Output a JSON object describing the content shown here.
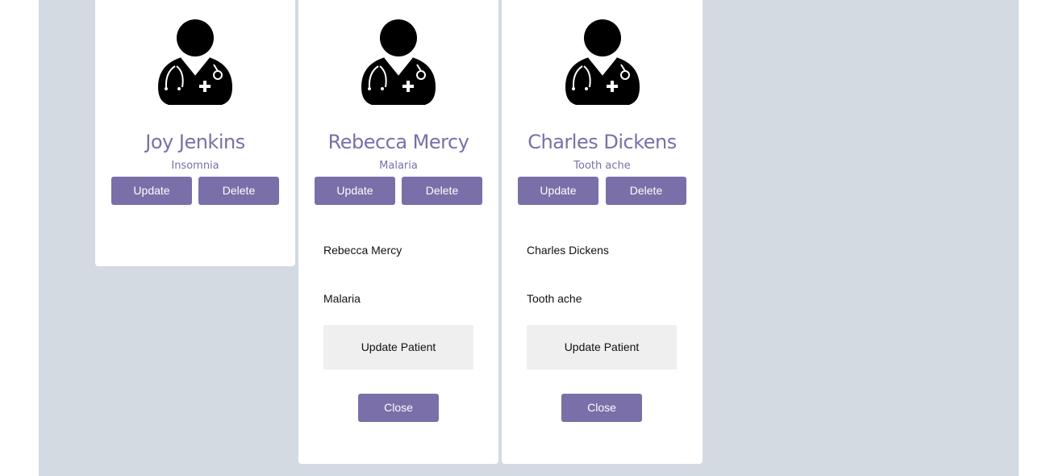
{
  "colors": {
    "accent": "#7a6fa8",
    "panel_background": "#d3dae2",
    "card_background": "#ffffff",
    "secondary_button": "#efefef"
  },
  "cards": [
    {
      "icon": "doctor-icon",
      "name": "Joy Jenkins",
      "ailment": "Insomnia",
      "update_label": "Update",
      "delete_label": "Delete"
    },
    {
      "icon": "doctor-icon",
      "name": "Rebecca Mercy",
      "ailment": "Malaria",
      "update_label": "Update",
      "delete_label": "Delete",
      "form": {
        "name": "Rebecca Mercy",
        "ailment": "Malaria",
        "update_patient_label": "Update Patient",
        "close_label": "Close"
      }
    },
    {
      "icon": "doctor-icon",
      "name": "Charles Dickens",
      "ailment": "Tooth ache",
      "update_label": "Update",
      "delete_label": "Delete",
      "form": {
        "name": "Charles Dickens",
        "ailment": "Tooth ache",
        "update_patient_label": "Update Patient",
        "close_label": "Close"
      }
    }
  ]
}
